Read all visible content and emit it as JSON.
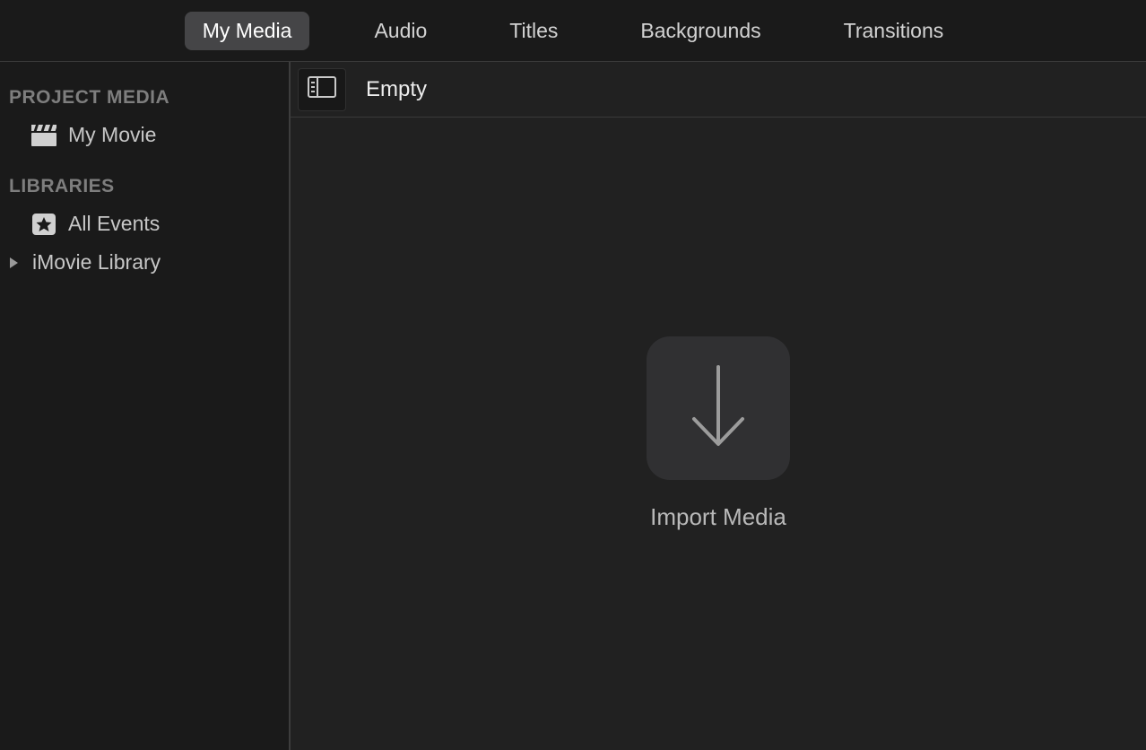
{
  "tabs": [
    {
      "label": "My Media",
      "active": true
    },
    {
      "label": "Audio",
      "active": false
    },
    {
      "label": "Titles",
      "active": false
    },
    {
      "label": "Backgrounds",
      "active": false
    },
    {
      "label": "Transitions",
      "active": false
    }
  ],
  "sidebar": {
    "section1": {
      "header": "PROJECT MEDIA",
      "items": [
        {
          "label": "My Movie"
        }
      ]
    },
    "section2": {
      "header": "LIBRARIES",
      "items": [
        {
          "label": "All Events"
        },
        {
          "label": "iMovie Library"
        }
      ]
    }
  },
  "content": {
    "header_title": "Empty",
    "import_label": "Import Media"
  }
}
